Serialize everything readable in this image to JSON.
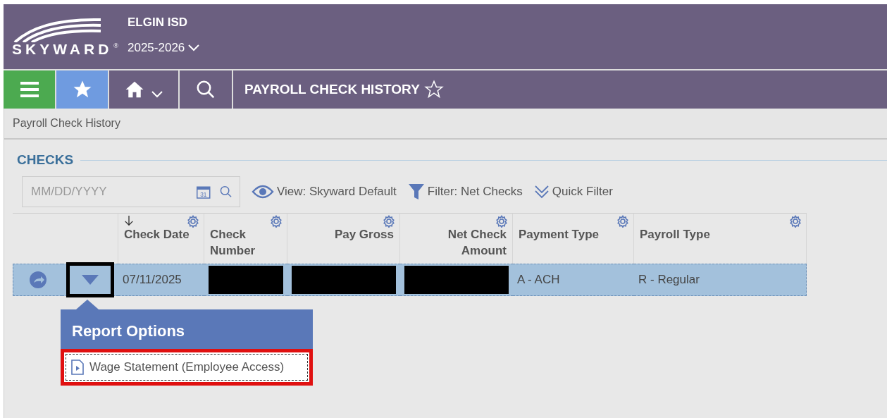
{
  "header": {
    "logo_text": "SKYWARD",
    "logo_mark": "®",
    "district": "ELGIN ISD",
    "school_year": "2025-2026"
  },
  "nav": {
    "page_title": "PAYROLL CHECK HISTORY"
  },
  "breadcrumb": "Payroll Check History",
  "section": {
    "title": "CHECKS"
  },
  "toolbar": {
    "date_placeholder": "MM/DD/YYYY",
    "calendar_day": "31",
    "view": "View: Skyward Default",
    "filter": "Filter: Net Checks",
    "quick_filter": "Quick Filter"
  },
  "table": {
    "columns": [
      {
        "label": "Check Date",
        "kind": "text",
        "sorted": true
      },
      {
        "label": "Check Number",
        "kind": "text",
        "sorted": false
      },
      {
        "label": "Pay Gross",
        "kind": "amount",
        "sorted": false
      },
      {
        "label": "Net Check Amount",
        "kind": "amount",
        "sorted": false
      },
      {
        "label": "Payment Type",
        "kind": "text",
        "sorted": false
      },
      {
        "label": "Payroll Type",
        "kind": "text",
        "sorted": false
      }
    ],
    "rows": [
      {
        "selected": true,
        "menu_outlined": true,
        "cells": [
          {
            "kind": "text",
            "text": "07/11/2025"
          },
          {
            "kind": "redacted"
          },
          {
            "kind": "redacted"
          },
          {
            "kind": "redacted"
          },
          {
            "kind": "text",
            "text": "A - ACH"
          },
          {
            "kind": "text",
            "text": "R - Regular"
          }
        ]
      }
    ]
  },
  "popup": {
    "title": "Report Options",
    "items": [
      {
        "label": "Wage Statement (Employee Access)",
        "highlighted": true
      }
    ]
  }
}
